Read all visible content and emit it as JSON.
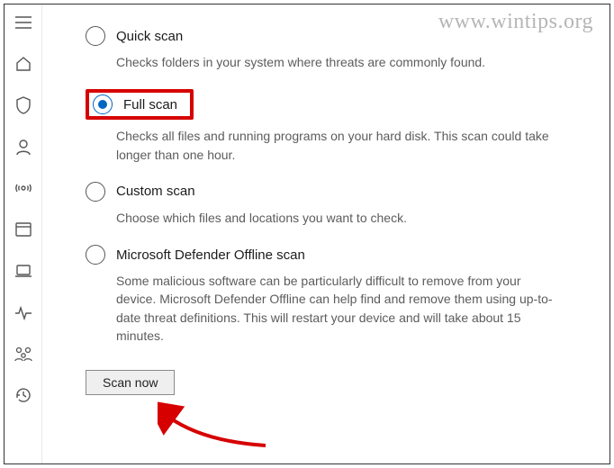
{
  "watermark": "www.wintips.org",
  "sidebar": {
    "items": [
      {
        "name": "menu-icon"
      },
      {
        "name": "home-icon"
      },
      {
        "name": "shield-icon"
      },
      {
        "name": "account-icon"
      },
      {
        "name": "firewall-icon"
      },
      {
        "name": "app-browser-icon"
      },
      {
        "name": "device-security-icon"
      },
      {
        "name": "performance-icon"
      },
      {
        "name": "family-icon"
      },
      {
        "name": "history-icon"
      }
    ]
  },
  "options": {
    "quick": {
      "title": "Quick scan",
      "desc": "Checks folders in your system where threats are commonly found.",
      "selected": false
    },
    "full": {
      "title": "Full scan",
      "desc": "Checks all files and running programs on your hard disk. This scan could take longer than one hour.",
      "selected": true
    },
    "custom": {
      "title": "Custom scan",
      "desc": "Choose which files and locations you want to check.",
      "selected": false
    },
    "offline": {
      "title": "Microsoft Defender Offline scan",
      "desc": "Some malicious software can be particularly difficult to remove from your device. Microsoft Defender Offline can help find and remove them using up-to-date threat definitions. This will restart your device and will take about 15 minutes.",
      "selected": false
    }
  },
  "actions": {
    "scan_now": "Scan now"
  }
}
